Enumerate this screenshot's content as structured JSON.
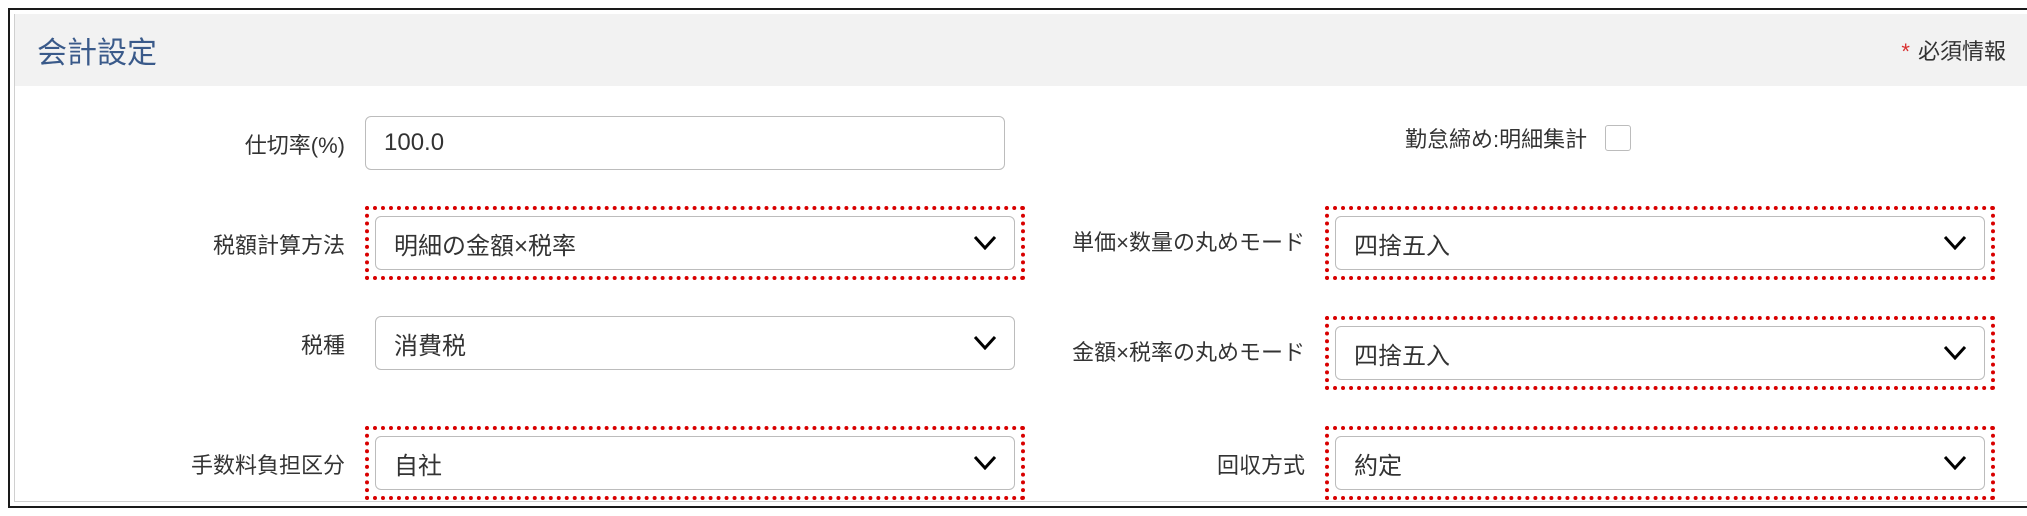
{
  "panel": {
    "title": "会計設定",
    "required_label": "必須情報"
  },
  "fields": {
    "partition_rate": {
      "label": "仕切率(%)",
      "value": "100.0"
    },
    "attendance_closing": {
      "label": "勤怠締め:明細集計",
      "checked": false
    },
    "tax_calc_method": {
      "label": "税額計算方法",
      "value": "明細の金額×税率"
    },
    "unit_qty_rounding": {
      "label": "単価×数量の丸めモード",
      "value": "四捨五入"
    },
    "tax_type": {
      "label": "税種",
      "value": "消費税"
    },
    "amount_tax_rounding": {
      "label": "金額×税率の丸めモード",
      "value": "四捨五入"
    },
    "fee_burden": {
      "label": "手数料負担区分",
      "value": "自社"
    },
    "collection_method": {
      "label": "回収方式",
      "value": "約定"
    }
  }
}
